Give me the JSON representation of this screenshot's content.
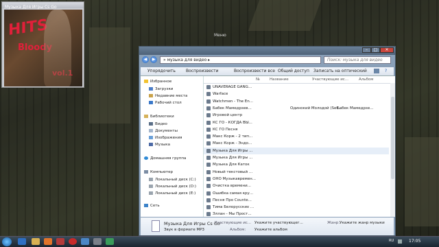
{
  "desktop_caption": "Меню",
  "media": {
    "title": "Музыка Для Игры Cs Go",
    "art_text": [
      "HITS",
      "Bloody",
      "vol.1"
    ]
  },
  "window": {
    "path": "музыка для видео",
    "search_placeholder": "Поиск: музыка для видео",
    "toolbar": [
      "Упорядочить",
      "Воспроизвести",
      "Воспроизвести все",
      "Общий доступ",
      "Записать на оптический диск"
    ],
    "nav": {
      "favorites": "Избранное",
      "favorites_items": [
        "Загрузки",
        "Недавние места",
        "Рабочий стол"
      ],
      "libraries": "Библиотеки",
      "library_items": [
        "Видео",
        "Документы",
        "Изображения",
        "Музыка"
      ],
      "homegroup": "Домашняя группа",
      "computer": "Компьютер",
      "drives": [
        "Локальный диск (C:)",
        "Локальный диск (D:)",
        "Локальный диск (E:)"
      ],
      "network": "Сеть"
    },
    "columns": [
      "№",
      "Название",
      "Участвующие ис...",
      "Альбом"
    ],
    "files": [
      {
        "name": "UNAVERAGE GANG...",
        "artist": "",
        "album": ""
      },
      {
        "name": "Warface",
        "artist": "",
        "album": ""
      },
      {
        "name": "Watchmen - The En...",
        "artist": "",
        "album": ""
      },
      {
        "name": "Бабек Мамедрзев...",
        "artist": "Одинокий Молодой (Sef...",
        "album": "Бабек Мамедрзе..."
      },
      {
        "name": "Игровой центр",
        "artist": "",
        "album": ""
      },
      {
        "name": "КС ГО - КОГДА ВЫ...",
        "artist": "",
        "album": ""
      },
      {
        "name": "КС ГО Песня",
        "artist": "",
        "album": ""
      },
      {
        "name": "Макс Корж - 2 тип...",
        "artist": "",
        "album": ""
      },
      {
        "name": "Макс Корж - Эндо...",
        "artist": "",
        "album": ""
      },
      {
        "name": "Музыка Для Игры ...",
        "artist": "",
        "album": ""
      },
      {
        "name": "Музыка Для Игры ...",
        "artist": "",
        "album": ""
      },
      {
        "name": "Музыка Для Каток",
        "artist": "",
        "album": ""
      },
      {
        "name": "Новый текстовый ...",
        "artist": "",
        "album": ""
      },
      {
        "name": "ОНО Музыкавремен...",
        "artist": "",
        "album": ""
      },
      {
        "name": "Очистка времени...",
        "artist": "",
        "album": ""
      },
      {
        "name": "Ошибка самая кру...",
        "artist": "",
        "album": ""
      },
      {
        "name": "Песня Про Counte...",
        "artist": "",
        "album": ""
      },
      {
        "name": "Тима Белорусских ...",
        "artist": "",
        "album": ""
      },
      {
        "name": "Эллан - Мы Прост...",
        "artist": "",
        "album": ""
      }
    ],
    "selected_index": 9,
    "details": {
      "name": "Музыка Для Игры Cs Go",
      "type": "Звук в формате MP3",
      "artist_label": "Участвующие ис...",
      "artist_value": "Укажите участвующег...",
      "album_label": "Альбом:",
      "album_value": "Укажите альбом",
      "genre_label": "Жанр:",
      "genre_value": "Укажите жанр музыки"
    }
  },
  "taskbar": {
    "lang": "RU",
    "clock": "17:05"
  },
  "colors": {
    "accent": "#2560b0",
    "art_text": "#e0203a"
  }
}
